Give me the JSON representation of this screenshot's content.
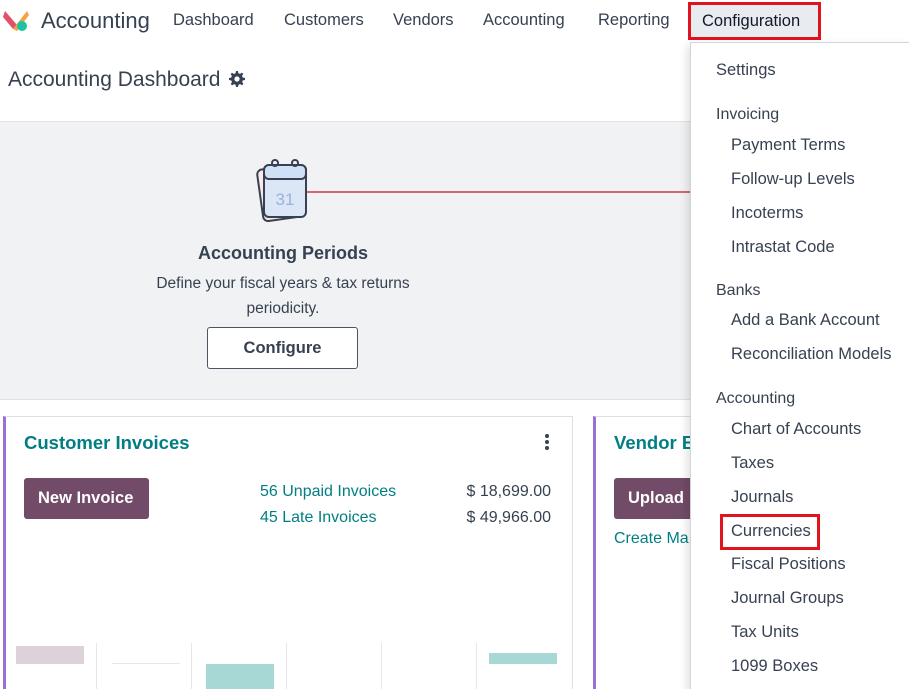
{
  "navbar": {
    "app_name": "Accounting",
    "menus": [
      "Dashboard",
      "Customers",
      "Vendors",
      "Accounting",
      "Reporting"
    ],
    "active_menu": "Configuration"
  },
  "page": {
    "title": "Accounting Dashboard"
  },
  "onboarding": {
    "calendar_day": "31",
    "step_title": "Accounting Periods",
    "step_description": "Define your fiscal years & tax returns periodicity.",
    "configure_label": "Configure"
  },
  "customer_invoices": {
    "title": "Customer Invoices",
    "new_button": "New Invoice",
    "unpaid_label": "56 Unpaid Invoices",
    "unpaid_amount": "$ 18,699.00",
    "late_label": "45 Late Invoices",
    "late_amount": "$ 49,966.00"
  },
  "vendor_bills": {
    "title": "Vendor B",
    "upload_button": "Upload",
    "create_manual": "Create Ma"
  },
  "config_menu": {
    "settings": "Settings",
    "sections": [
      {
        "header": "Invoicing",
        "items": [
          "Payment Terms",
          "Follow-up Levels",
          "Incoterms",
          "Intrastat Code"
        ]
      },
      {
        "header": "Banks",
        "items": [
          "Add a Bank Account",
          "Reconciliation Models"
        ]
      },
      {
        "header": "Accounting",
        "items": [
          "Chart of Accounts",
          "Taxes",
          "Journals",
          "Currencies",
          "Fiscal Positions",
          "Journal Groups",
          "Tax Units",
          "1099 Boxes"
        ]
      }
    ]
  },
  "colors": {
    "brand": "#714b67",
    "teal": "#017e84",
    "highlight": "#e0131f",
    "card_accent": "#9b6fd6"
  }
}
